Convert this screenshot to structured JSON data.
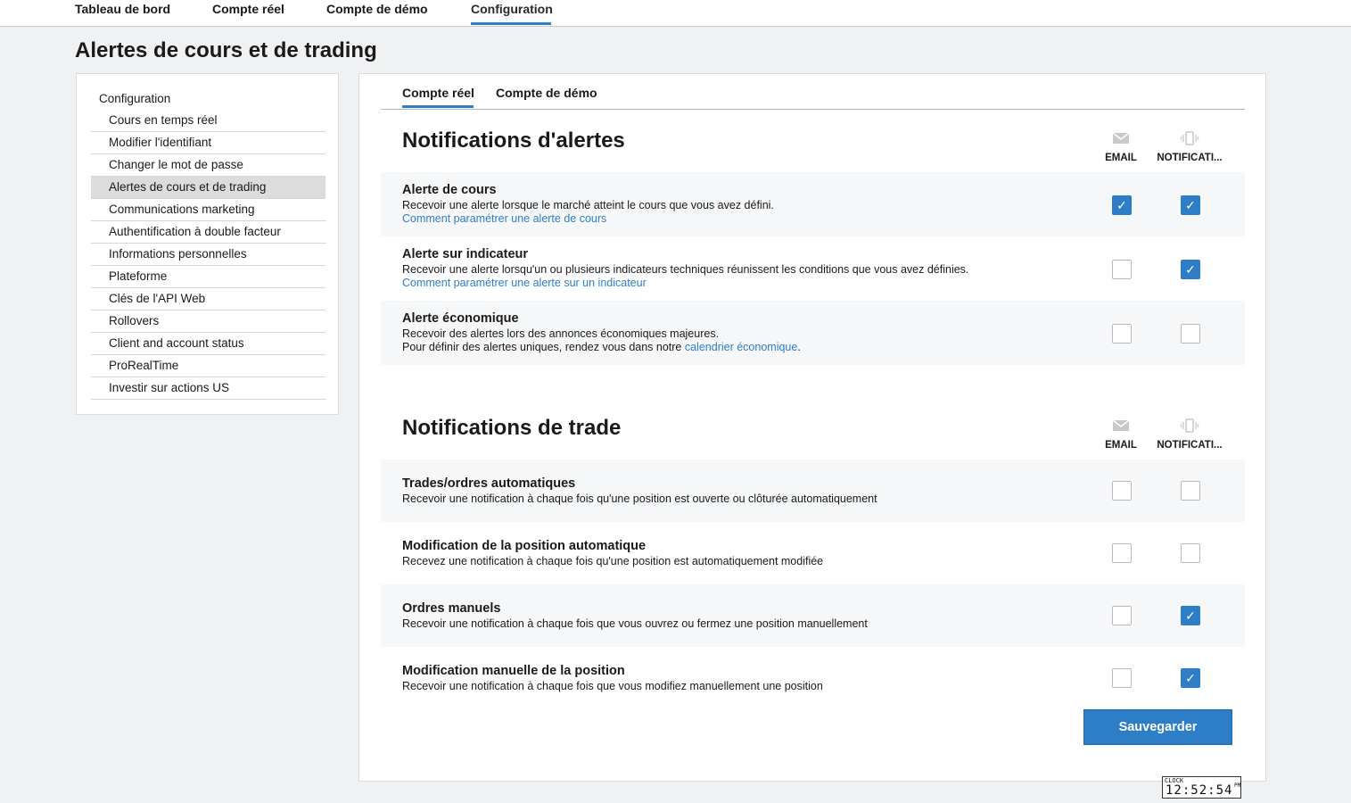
{
  "topnav": {
    "items": [
      {
        "label": "Tableau de bord"
      },
      {
        "label": "Compte réel"
      },
      {
        "label": "Compte de démo"
      },
      {
        "label": "Configuration"
      }
    ]
  },
  "page": {
    "title": "Alertes de cours et de trading"
  },
  "sidebar": {
    "header": "Configuration",
    "items": [
      {
        "label": "Cours en temps réel"
      },
      {
        "label": "Modifier l'identifiant"
      },
      {
        "label": "Changer le mot de passe"
      },
      {
        "label": "Alertes de cours et de trading"
      },
      {
        "label": "Communications marketing"
      },
      {
        "label": "Authentification à double facteur"
      },
      {
        "label": "Informations personnelles"
      },
      {
        "label": "Plateforme"
      },
      {
        "label": "Clés de l'API Web"
      },
      {
        "label": "Rollovers"
      },
      {
        "label": "Client and account status"
      },
      {
        "label": "ProRealTime"
      },
      {
        "label": "Investir sur actions US"
      }
    ]
  },
  "tabs": [
    {
      "label": "Compte réel"
    },
    {
      "label": "Compte de démo"
    }
  ],
  "columns": {
    "email": "EMAIL",
    "notification": "NOTIFICATI..."
  },
  "alerts": {
    "title": "Notifications d'alertes",
    "rows": [
      {
        "title": "Alerte de cours",
        "desc": "Recevoir une alerte lorsque le marché atteint le cours que vous avez défini.",
        "link": "Comment paramétrer une alerte de cours",
        "email": true,
        "notif": true
      },
      {
        "title": "Alerte sur indicateur",
        "desc": "Recevoir une alerte lorsqu'un ou plusieurs indicateurs techniques réunissent les conditions que vous avez définies.",
        "link": "Comment paramétrer une alerte sur un indicateur",
        "email": false,
        "notif": true
      },
      {
        "title": "Alerte économique",
        "desc": "Recevoir des alertes lors des annonces économiques majeures.",
        "desc2_pre": "Pour définir des alertes uniques, rendez vous dans notre ",
        "desc2_link": "calendrier économique",
        "desc2_post": ".",
        "email": false,
        "notif": false
      }
    ]
  },
  "trades": {
    "title": "Notifications de trade",
    "rows": [
      {
        "title": "Trades/ordres automatiques",
        "desc": "Recevoir une notification à chaque fois qu'une position est ouverte ou clôturée automatiquement",
        "email": false,
        "notif": false
      },
      {
        "title": "Modification de la position automatique",
        "desc": "Recevez une notification à chaque fois qu'une position est automatiquement modifiée",
        "email": false,
        "notif": false
      },
      {
        "title": "Ordres manuels",
        "desc": "Recevoir une notification à chaque fois que vous ouvrez ou fermez une position manuellement",
        "email": false,
        "notif": true
      },
      {
        "title": "Modification manuelle de la position",
        "desc": "Recevoir une notification à chaque fois que vous modifiez manuellement une position",
        "email": false,
        "notif": true
      }
    ]
  },
  "save_label": "Sauvegarder",
  "clock": {
    "label": "CLOCK",
    "time": "12:52:54",
    "ampm": "PM"
  },
  "icons": {
    "email": "envelope-icon",
    "notification": "vibrating-phone-icon",
    "check": "checkmark-icon"
  },
  "colors": {
    "accent": "#2e7ec7",
    "background": "#f0f1f2"
  }
}
